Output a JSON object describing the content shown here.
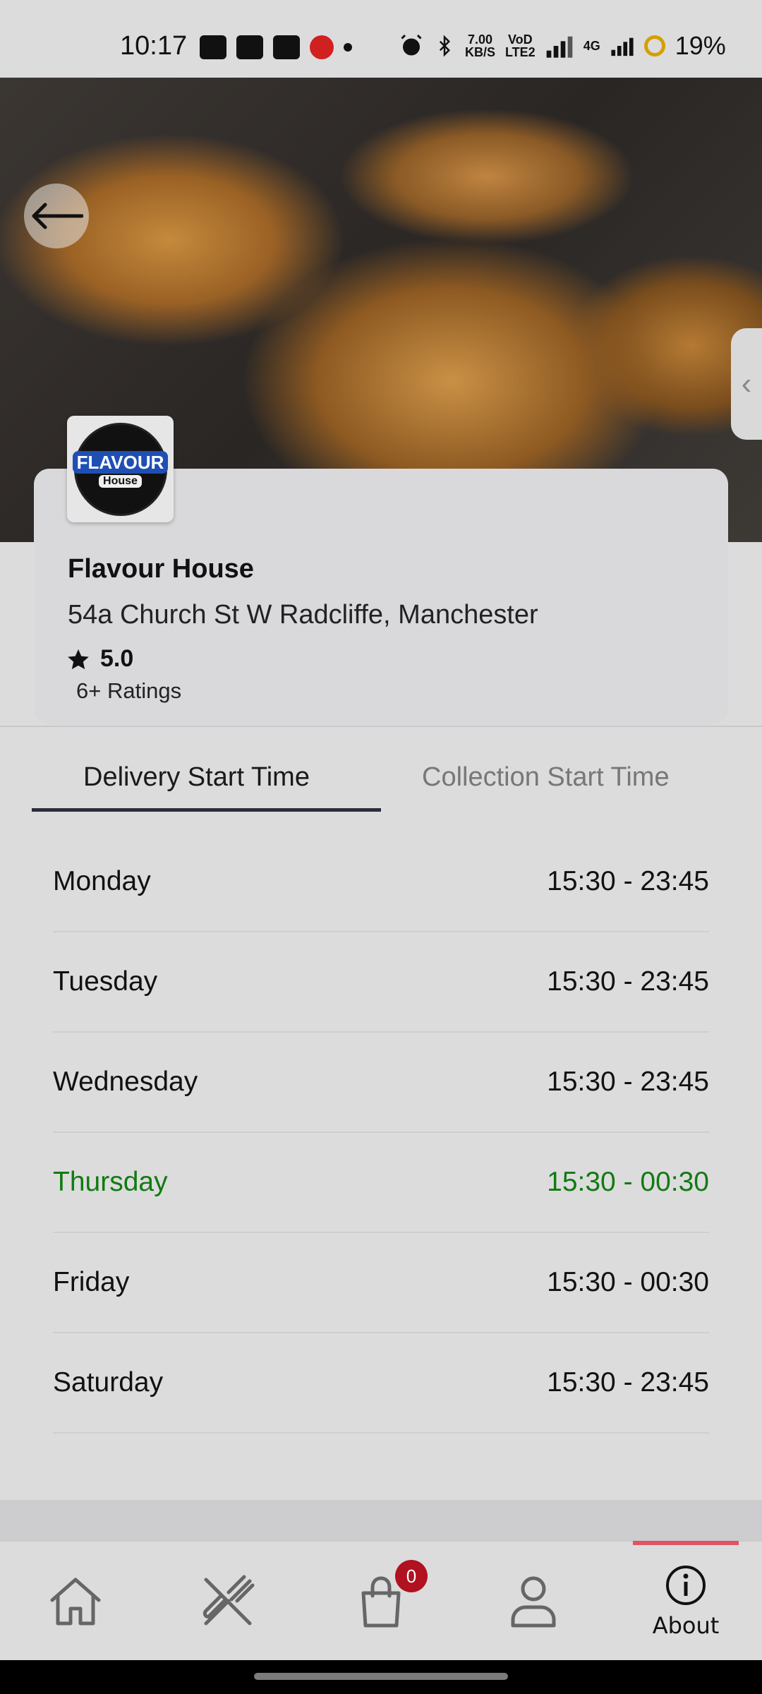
{
  "status_bar": {
    "time": "10:17",
    "network_speed_value": "7.00",
    "network_speed_unit": "KB/S",
    "volte_top": "VoD",
    "volte_bottom": "LTE2",
    "network_type": "4G",
    "battery": "19%"
  },
  "restaurant": {
    "logo_word": "FLAVOUR",
    "logo_sub": "House",
    "name": "Flavour House",
    "address": "54a Church St W Radcliffe, Manchester",
    "rating": "5.0",
    "ratings_count": "6+ Ratings"
  },
  "tabs": {
    "delivery": "Delivery Start Time",
    "collection": "Collection Start Time"
  },
  "schedule": [
    {
      "day": "Monday",
      "hours": "15:30 - 23:45"
    },
    {
      "day": "Tuesday",
      "hours": "15:30 - 23:45"
    },
    {
      "day": "Wednesday",
      "hours": "15:30 - 23:45"
    },
    {
      "day": "Thursday",
      "hours": "15:30 - 00:30"
    },
    {
      "day": "Friday",
      "hours": "15:30 - 00:30"
    },
    {
      "day": "Saturday",
      "hours": "15:30 - 23:45"
    }
  ],
  "bottom_nav": {
    "cart_count": "0",
    "about_label": "About"
  },
  "colors": {
    "accent_today": "#127a12",
    "active_tab_bar": "#e05560",
    "cart_badge": "#b0121f"
  },
  "icons": [
    "back-arrow-icon",
    "home-icon",
    "fork-knife-icon",
    "shopping-bag-icon",
    "user-icon",
    "info-icon",
    "star-icon"
  ]
}
